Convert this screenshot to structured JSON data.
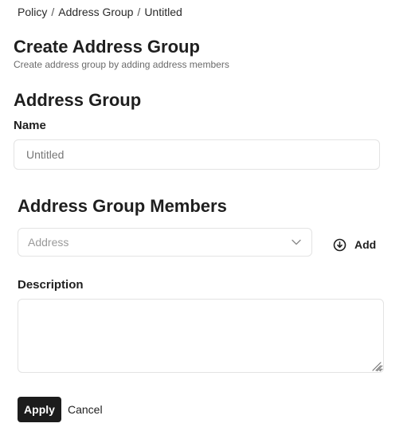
{
  "breadcrumb": {
    "items": [
      "Policy",
      "Address Group",
      "Untitled"
    ],
    "separator": "/"
  },
  "header": {
    "title": "Create Address Group",
    "subtitle": "Create address group by adding address members"
  },
  "address_group": {
    "section_title": "Address Group",
    "name_label": "Name",
    "name_placeholder": "Untitled",
    "name_value": ""
  },
  "members": {
    "section_title": "Address Group Members",
    "address_placeholder": "Address",
    "add_label": "Add"
  },
  "description": {
    "label": "Description",
    "value": ""
  },
  "actions": {
    "apply_label": "Apply",
    "cancel_label": "Cancel"
  },
  "icons": {
    "dropdown": "chevron-down-icon",
    "add": "circle-arrow-down-icon",
    "resize": "resize-grip-icon"
  },
  "colors": {
    "primary_button_bg": "#1c1c1c",
    "primary_button_text": "#ffffff",
    "border": "#e3e3e3",
    "text": "#1f1f1f",
    "muted_text": "#6b6b6b"
  }
}
